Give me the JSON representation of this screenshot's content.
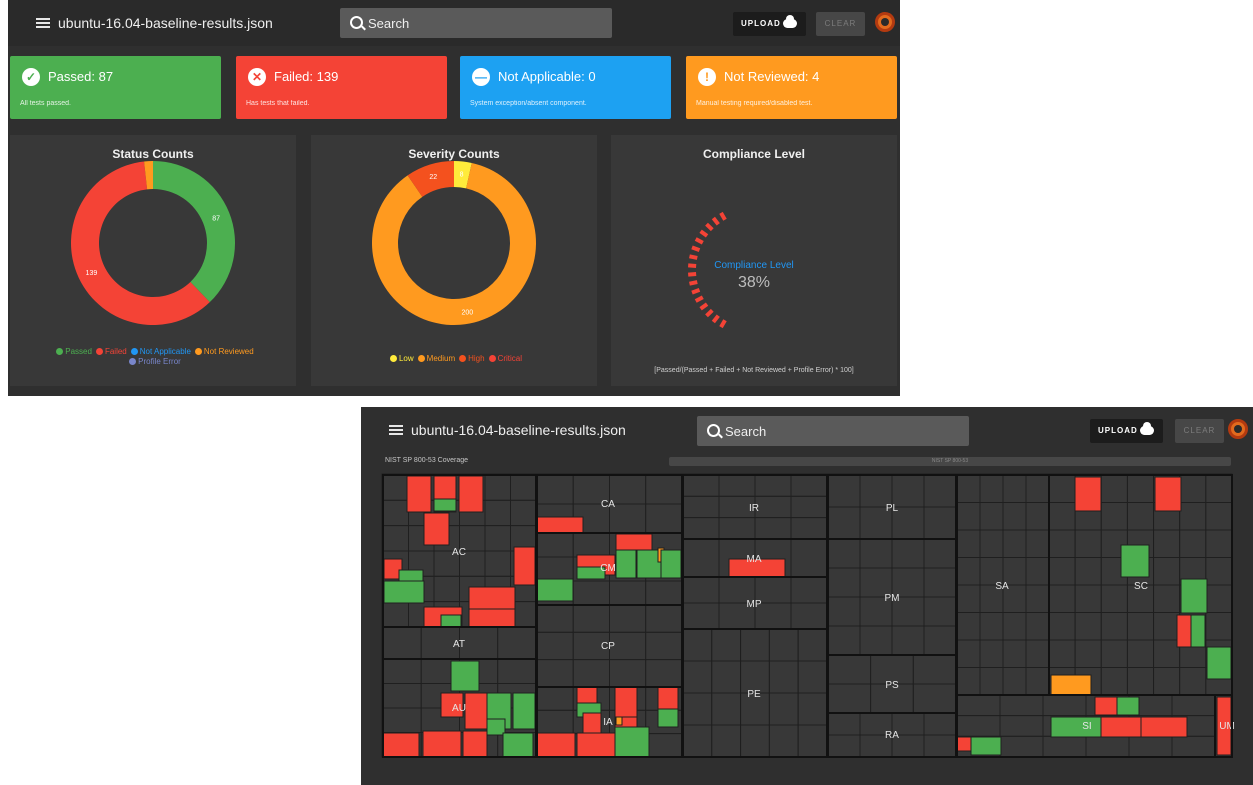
{
  "app": {
    "title": "ubuntu-16.04-baseline-results.json",
    "search_placeholder": "Search",
    "upload_label": "UPLOAD",
    "clear_label": "CLEAR"
  },
  "cards": [
    {
      "title": "Passed: 87",
      "subtitle": "All tests passed.",
      "color": "#4caf50",
      "icon": "check-circle-icon",
      "glyph": "✓"
    },
    {
      "title": "Failed: 139",
      "subtitle": "Has tests that failed.",
      "color": "#f44336",
      "icon": "close-circle-icon",
      "glyph": "✕"
    },
    {
      "title": "Not Applicable: 0",
      "subtitle": "System exception/absent component.",
      "color": "#1da1f2",
      "icon": "minus-circle-icon",
      "glyph": "—"
    },
    {
      "title": "Not Reviewed: 4",
      "subtitle": "Manual testing required/disabled test.",
      "color": "#ff9a1f",
      "icon": "exclamation-circle-icon",
      "glyph": "!"
    }
  ],
  "panels": {
    "status_title": "Status Counts",
    "severity_title": "Severity Counts",
    "compliance_title": "Compliance Level",
    "compliance_label": "Compliance Level",
    "compliance_value": "38%",
    "compliance_formula": "[Passed/(Passed + Failed + Not Reviewed + Profile Error) * 100]"
  },
  "chart_data": [
    {
      "type": "pie",
      "title": "Status Counts",
      "categories": [
        "Passed",
        "Failed",
        "Not Applicable",
        "Not Reviewed",
        "Profile Error"
      ],
      "values": [
        87,
        139,
        0,
        4,
        0
      ],
      "labels_shown": [
        "87",
        "139"
      ],
      "colors": [
        "#4caf50",
        "#f44336",
        "#2196f3",
        "#ff9a1f",
        "#7986cb"
      ],
      "legend": "bottom"
    },
    {
      "type": "pie",
      "title": "Severity Counts",
      "categories": [
        "Low",
        "Medium",
        "High",
        "Critical"
      ],
      "values": [
        8,
        200,
        22,
        0
      ],
      "labels_shown": [
        "8",
        "200",
        "22"
      ],
      "colors": [
        "#ffeb3b",
        "#ff9a1f",
        "#f4511e",
        "#f44336"
      ],
      "legend": "bottom"
    },
    {
      "type": "gauge",
      "title": "Compliance Level",
      "value": 38,
      "color": "#f44336"
    }
  ],
  "coverage": {
    "label": "NIST SP 800-53 Coverage",
    "bar_text": "NIST SP 800-53",
    "families": [
      "AC",
      "CA",
      "IR",
      "PL",
      "SA",
      "AT",
      "CM",
      "MA",
      "MP",
      "PM",
      "SC",
      "CP",
      "PS",
      "AU",
      "IA",
      "PE",
      "RA",
      "SI",
      "UM"
    ]
  },
  "colors": {
    "passed": "#4caf50",
    "failed": "#f44336",
    "not_reviewed": "#ff9a1f",
    "empty": "#383838"
  }
}
